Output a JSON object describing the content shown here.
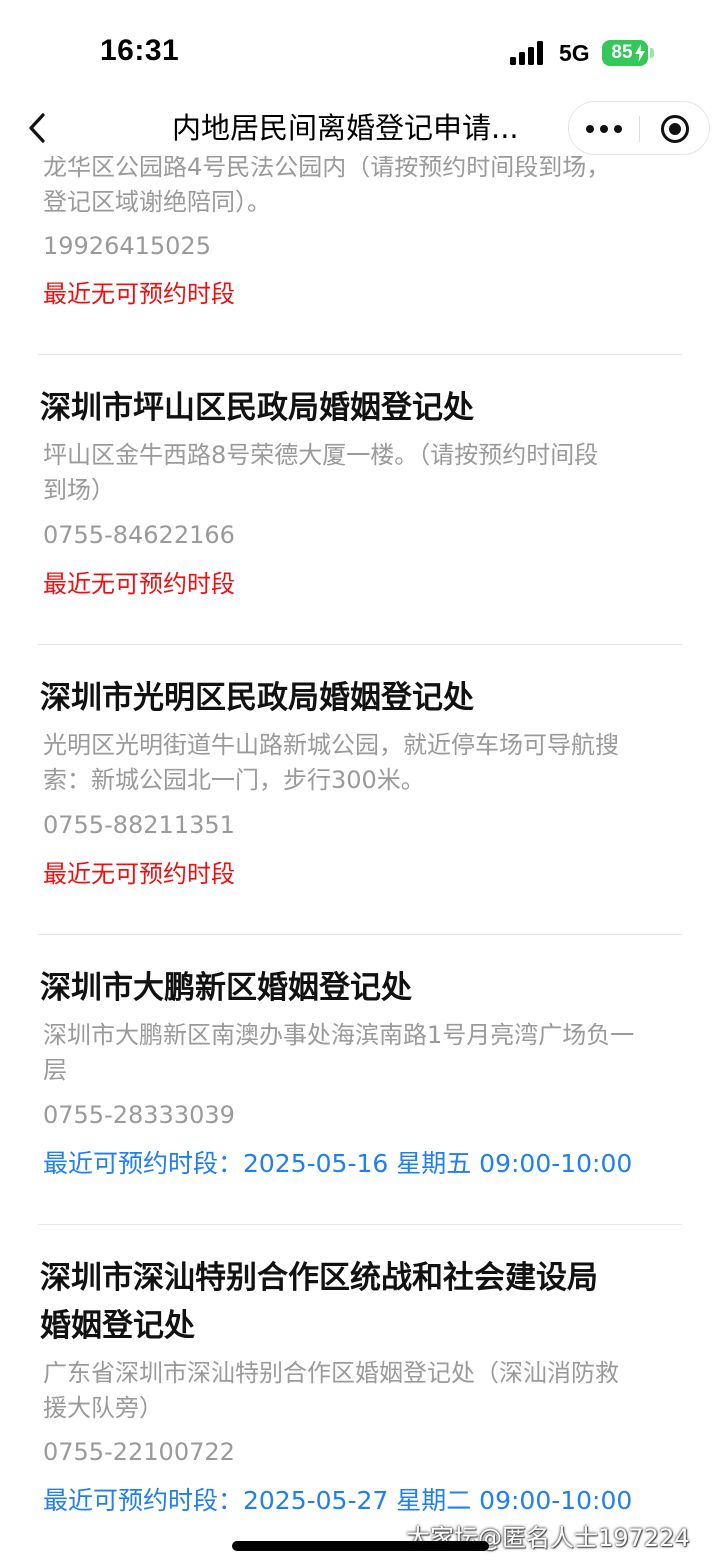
{
  "status_bar": {
    "time": "16:31",
    "network": "5G",
    "battery": "85",
    "battery_color": "#34c759"
  },
  "nav": {
    "title": "内地居民间离婚登记申请...",
    "icons": [
      "back-chevron-icon",
      "more-dots-icon",
      "close-circle-icon"
    ]
  },
  "offices": [
    {
      "address_lines": [
        "龙华区公园路4号民法公园内（请按预约时间段到场，",
        "登记区域谢绝陪同）。"
      ],
      "phone": "19926415025",
      "availability": "最近无可预约时段",
      "status": "none"
    },
    {
      "name": "深圳市坪山区民政局婚姻登记处",
      "address_lines": [
        "坪山区金牛西路8号荣德大厦一楼。（请按预约时间段",
        "到场）"
      ],
      "phone": "0755-84622166",
      "availability": "最近无可预约时段",
      "status": "none"
    },
    {
      "name": "深圳市光明区民政局婚姻登记处",
      "address_lines": [
        "光明区光明街道牛山路新城公园，就近停车场可导航搜",
        "索：新城公园北一门，步行300米。"
      ],
      "phone": "0755-88211351",
      "availability": "最近无可预约时段",
      "status": "none"
    },
    {
      "name": "深圳市大鹏新区婚姻登记处",
      "address_lines": [
        "深圳市大鹏新区南澳办事处海滨南路1号月亮湾广场负一",
        "层"
      ],
      "phone": "0755-28333039",
      "availability": "最近可预约时段：2025-05-16 星期五 09:00-10:00",
      "status": "available"
    },
    {
      "name_lines": [
        "深圳市深汕特别合作区统战和社会建设局",
        "婚姻登记处"
      ],
      "address_lines": [
        "广东省深圳市深汕特别合作区婚姻登记处（深汕消防救",
        "援大队旁）"
      ],
      "phone": "0755-22100722",
      "availability": "最近可预约时段：2025-05-27 星期二 09:00-10:00",
      "status": "available"
    }
  ],
  "colors": {
    "unavailable": "#ee1010",
    "available": "#1f7ff0",
    "secondary_text": "#9a9a9a"
  },
  "watermark": "大家坛@匿名人士197224"
}
